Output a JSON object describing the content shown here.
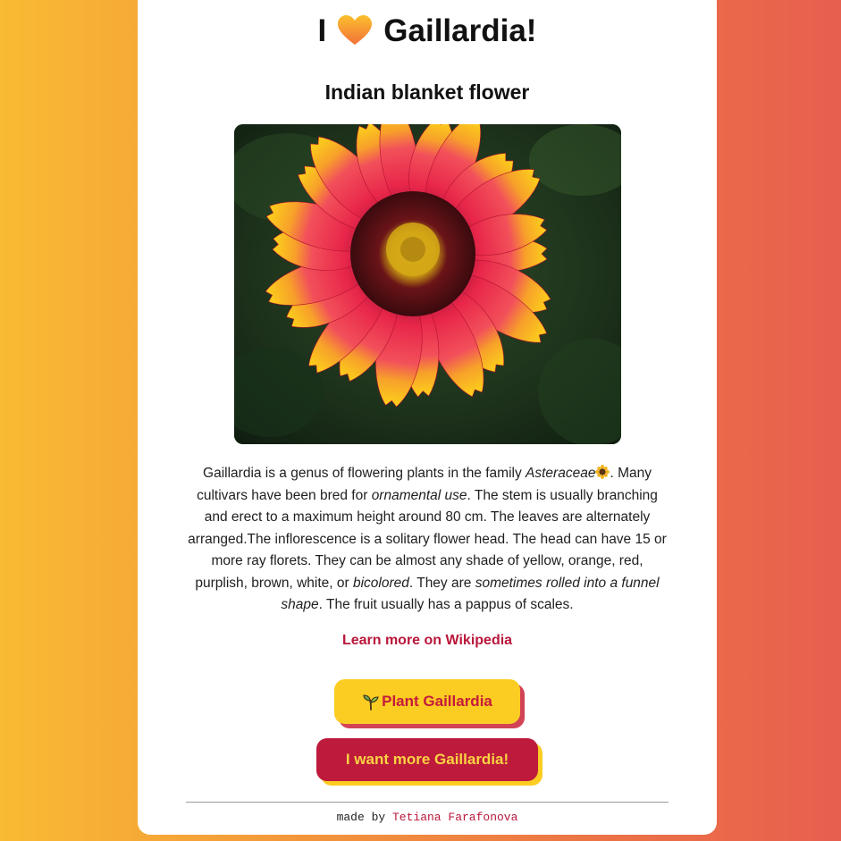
{
  "header": {
    "title_prefix": "I",
    "title_suffix": "Gaillardia!",
    "heart_icon": "orange-heart-icon",
    "subtitle": "Indian blanket flower"
  },
  "image": {
    "alt": "Gaillardia flower"
  },
  "description": {
    "p1": "Gaillardia is a genus of flowering plants in the family ",
    "family": "Asteraceae",
    "sunflower_icon": "sunflower-icon",
    "p2": ". Many cultivars have been bred for ",
    "ornamental": "ornamental use",
    "p3": ". The stem is usually branching and erect to a maximum height around 80 cm. The leaves are alternately arranged.The inflorescence is a solitary flower head. The head can have 15 or more ray florets. They can be almost any shade of yellow, orange, red, purplish, brown, white, or ",
    "bicolored": "bicolored",
    "p4": ". They are ",
    "sometimes": "sometimes rolled into a funnel shape",
    "p5": ". The fruit usually has a pappus of scales."
  },
  "link": {
    "label": "Learn more on Wikipedia"
  },
  "buttons": {
    "plant_label": "Plant Gaillardia",
    "plant_icon": "sprout-icon",
    "more_label": "I want more Gaillardia!"
  },
  "footer": {
    "prefix": "made by",
    "author": "Tetiana Farafonova"
  },
  "colors": {
    "background_start": "#f9bb33",
    "background_end": "#e75f4f",
    "accent_red": "#bd1a3c",
    "accent_yellow": "#fbcd22"
  }
}
